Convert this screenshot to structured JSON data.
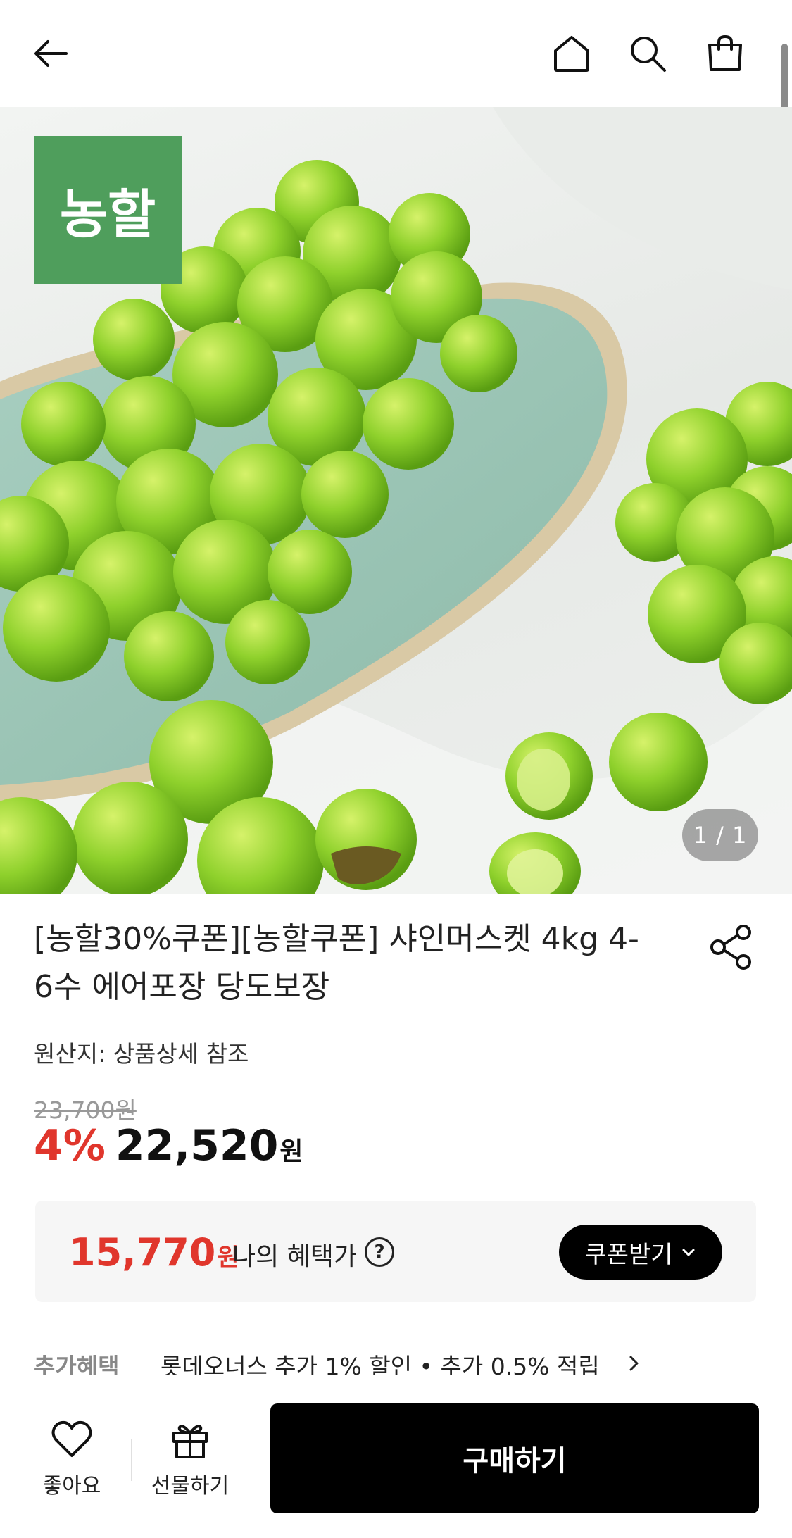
{
  "header": {
    "back_icon": "arrow-left-icon",
    "home_icon": "home-icon",
    "search_icon": "search-icon",
    "bag_icon": "shopping-bag-icon"
  },
  "hero": {
    "brand_logo_text": "농할",
    "image_counter": "1 / 1"
  },
  "product": {
    "title": "[농할30%쿠폰][농할쿠폰] 샤인머스켓 4kg 4-6수 에어포장 당도보장",
    "origin": "원산지: 상품상세 참조",
    "original_price": "23,700원",
    "discount_rate": "4%",
    "sale_price": "22,520",
    "currency": "원"
  },
  "benefit": {
    "price": "15,770",
    "currency": "원",
    "label": "나의 혜택가",
    "help_symbol": "?",
    "coupon_button": "쿠폰받기"
  },
  "extra_benefit": {
    "label": "추가혜택",
    "text": "롯데오너스 추가 1% 할인 • 추가 0.5% 적립"
  },
  "bottom_bar": {
    "like_label": "좋아요",
    "gift_label": "선물하기",
    "buy_label": "구매하기"
  },
  "colors": {
    "accent_red": "#e0362c",
    "brand_green": "#4f9e5c",
    "button_black": "#000000"
  }
}
